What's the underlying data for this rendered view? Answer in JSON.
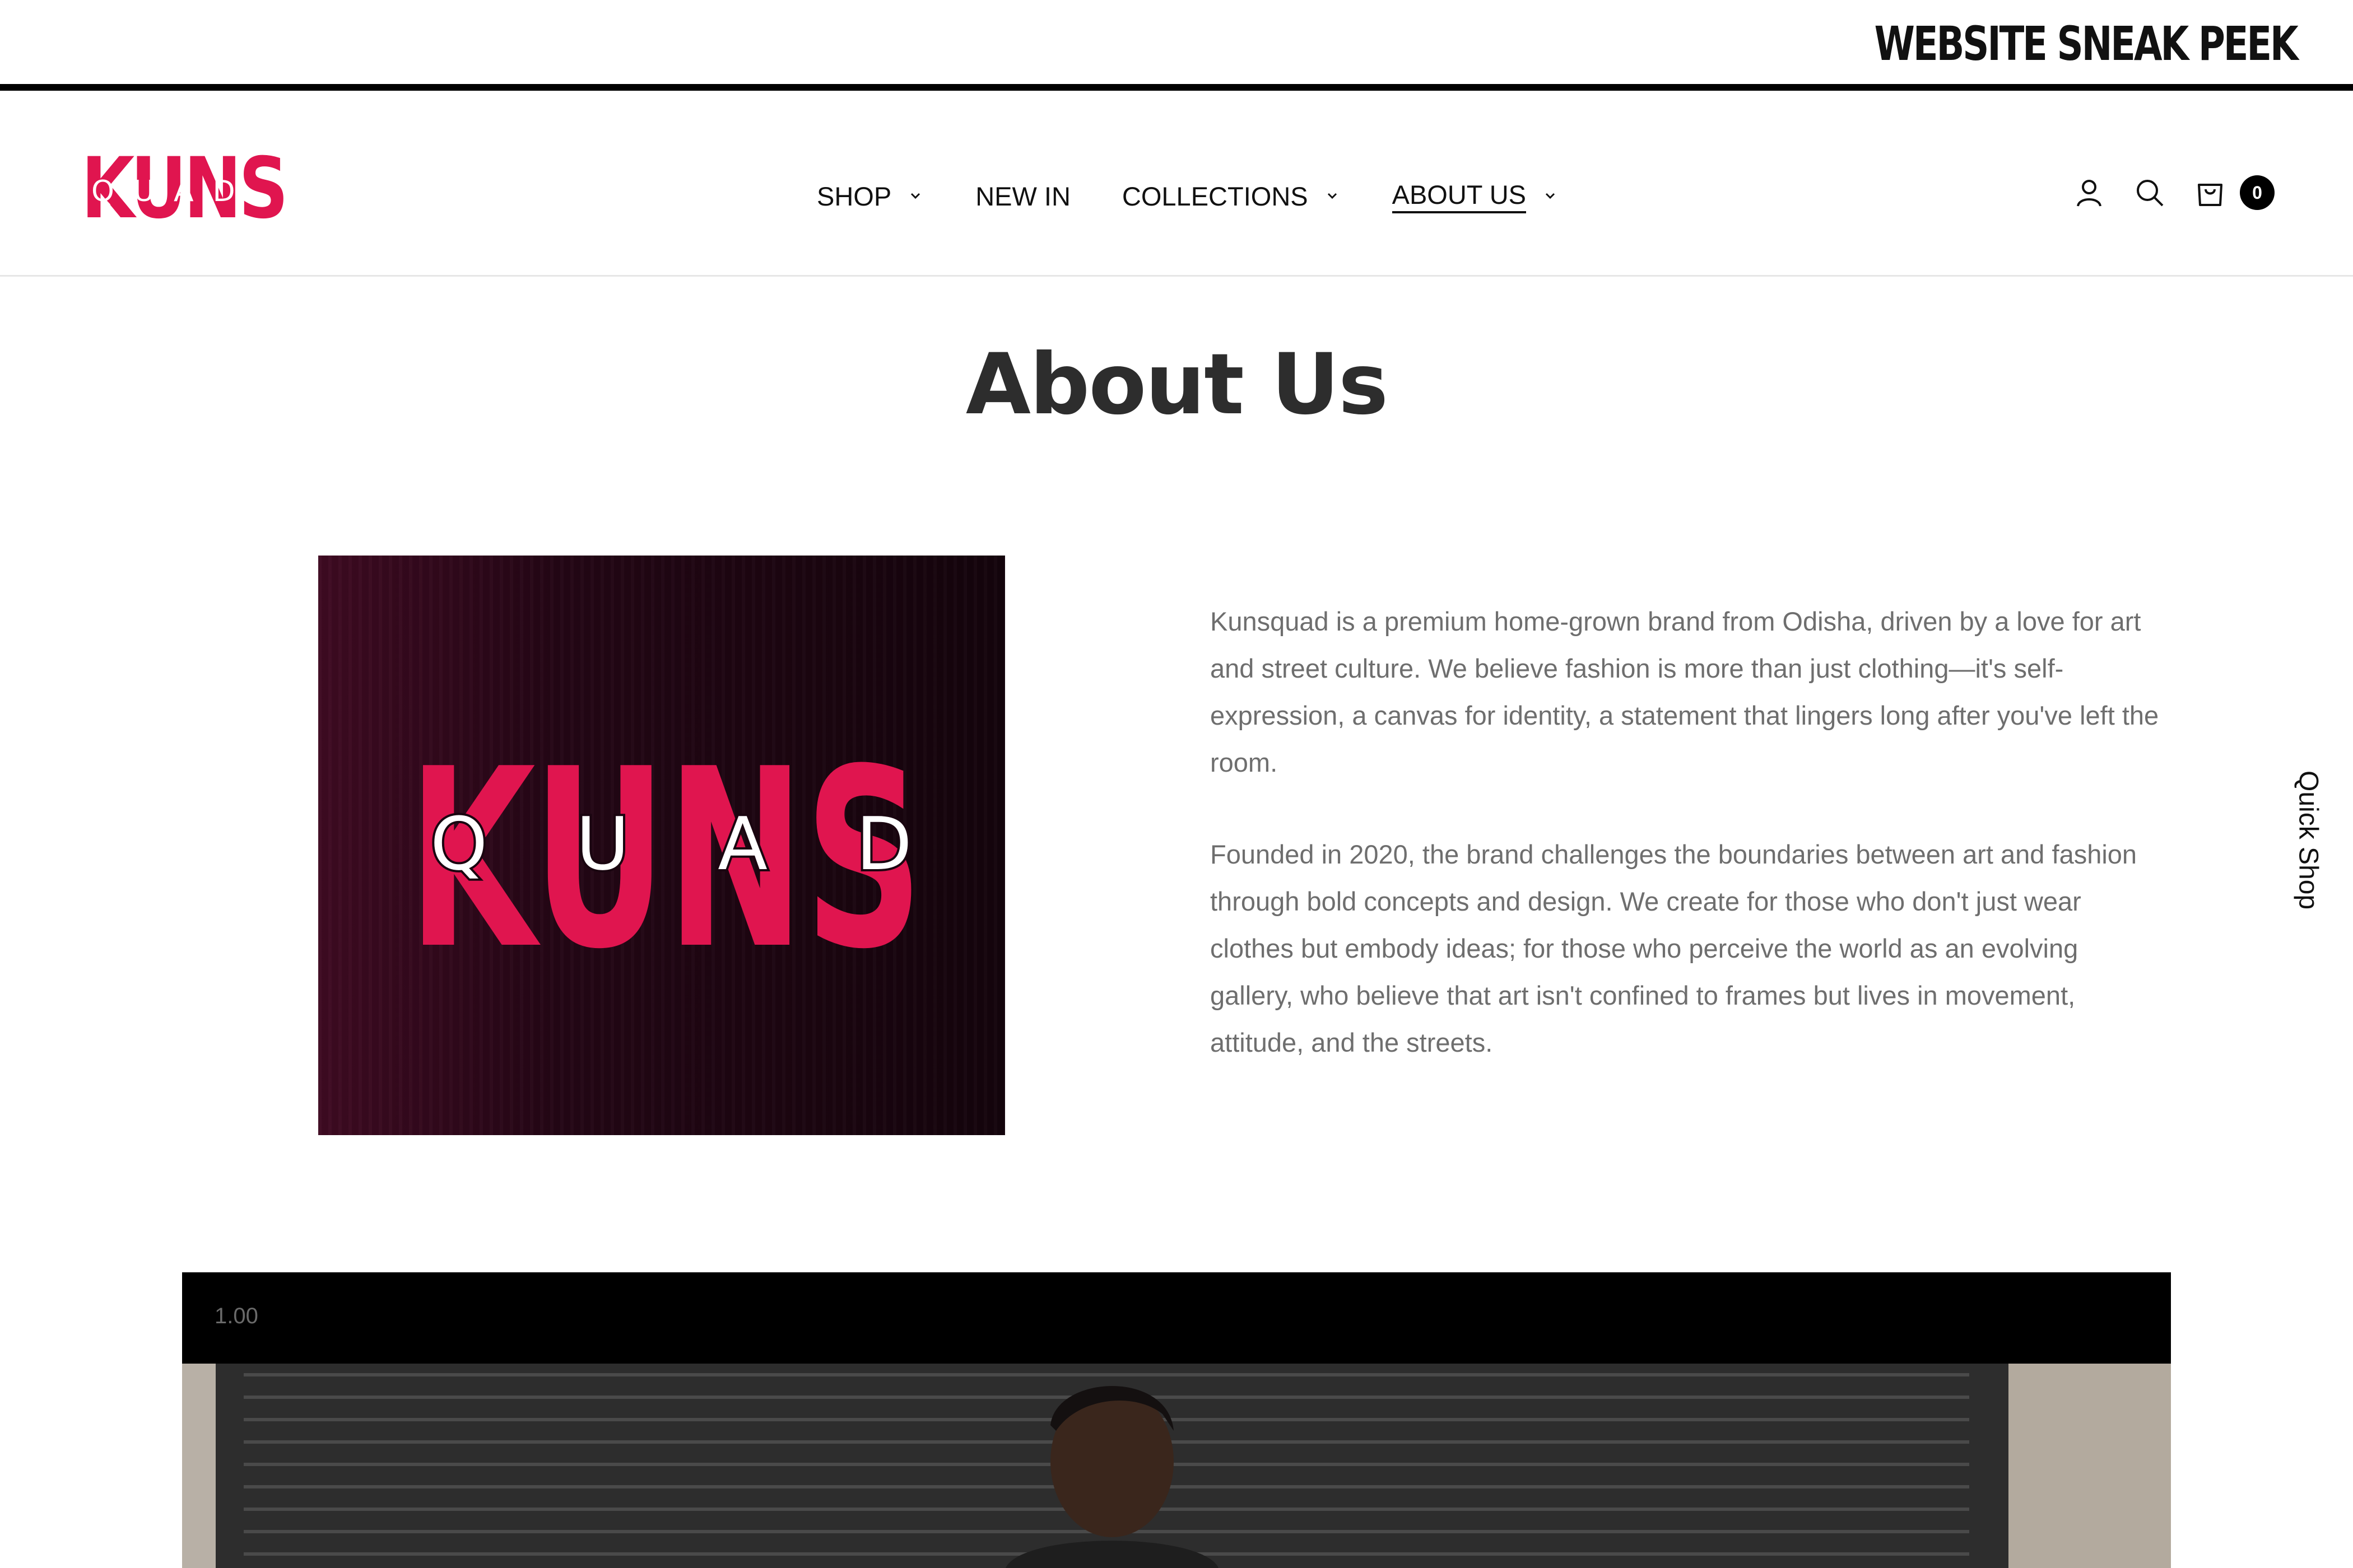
{
  "banner": {
    "text": "WEBSITE SNEAK PEEK"
  },
  "header": {
    "logo": {
      "word": "KUNS",
      "sub": "QUAD"
    },
    "nav": [
      {
        "label": "SHOP",
        "has_dropdown": true,
        "active": false
      },
      {
        "label": "NEW IN",
        "has_dropdown": false,
        "active": false
      },
      {
        "label": "COLLECTIONS",
        "has_dropdown": true,
        "active": false
      },
      {
        "label": "ABOUT US",
        "has_dropdown": true,
        "active": true
      }
    ],
    "icons": [
      "account-icon",
      "search-icon",
      "cart-icon"
    ],
    "cart_count": "0"
  },
  "page": {
    "title": "About Us",
    "image": {
      "logo_word": "KUNS",
      "logo_sub": "QUAD"
    },
    "paragraphs": [
      "Kunsquad is a premium home-grown brand from Odisha, driven by a love for art and street culture. We believe fashion is more than just clothing—it's self-expression, a canvas for identity, a statement that lingers long after you've left the room.",
      "Founded in 2020, the brand challenges the boundaries between art and fashion through bold concepts and design. We create for those who don't just wear clothes but embody ideas; for those who perceive the world as an evolving gallery, who believe that art isn't confined to frames but lives in movement, attitude, and the streets."
    ]
  },
  "quick_shop": {
    "label": "Quick Shop"
  },
  "video": {
    "speed": "1.00"
  },
  "colors": {
    "brand": "#e0154f",
    "dark_bg": "#1a0510",
    "text_muted": "#6e6e6e"
  }
}
